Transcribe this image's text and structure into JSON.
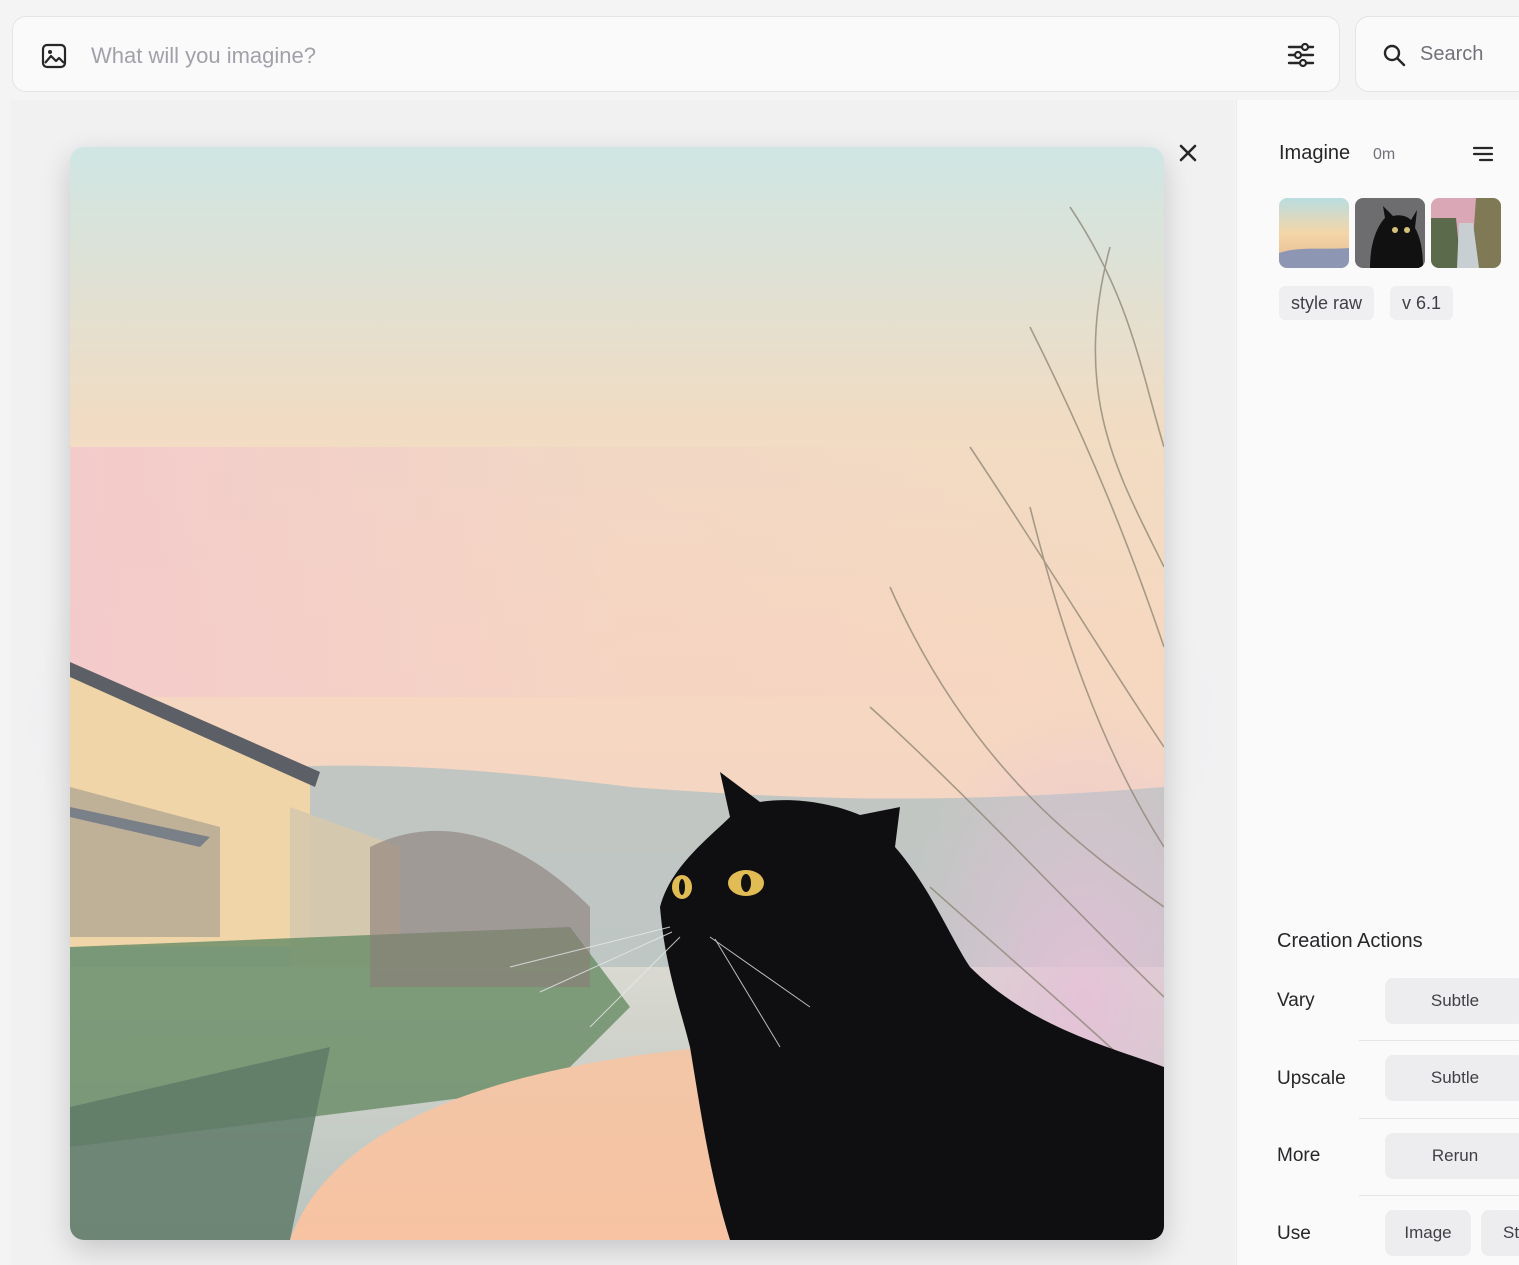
{
  "prompt": {
    "placeholder": "What will you imagine?"
  },
  "search": {
    "label": "Search"
  },
  "job": {
    "title": "Imagine",
    "time": "0m",
    "tags": [
      "style raw",
      "v 6.1"
    ]
  },
  "actions": {
    "section_title": "Creation Actions",
    "rows": [
      {
        "label": "Vary",
        "buttons": [
          "Subtle"
        ]
      },
      {
        "label": "Upscale",
        "buttons": [
          "Subtle"
        ]
      },
      {
        "label": "More",
        "buttons": [
          "Rerun"
        ]
      },
      {
        "label": "Use",
        "buttons": [
          "Image",
          "St"
        ]
      }
    ]
  },
  "icons": {
    "prompt_image": "image-icon",
    "settings": "sliders-icon",
    "search": "search-icon",
    "close": "close-icon",
    "menu": "menu-icon"
  }
}
